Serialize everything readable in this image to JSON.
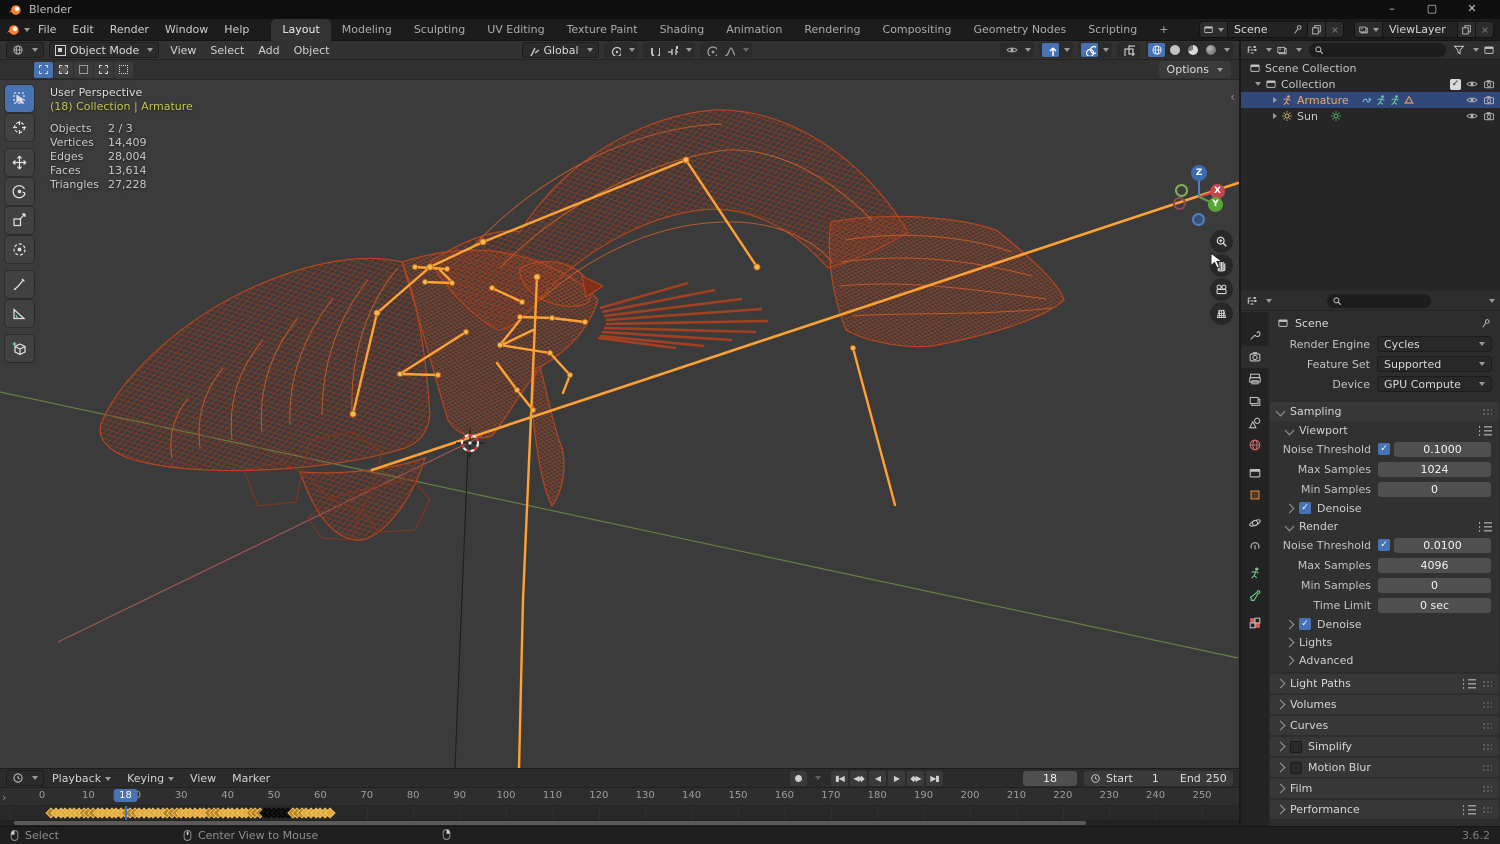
{
  "app": {
    "title": "Blender",
    "version": "3.6.2"
  },
  "colors": {
    "accent": "#4772b3",
    "selection_orange": "#ffa133",
    "wire": "#b5461f",
    "keyframe": "#e3aa3c",
    "selected_row": "#31497a"
  },
  "titlebar": {
    "minimize": "–",
    "maximize": "▢",
    "close": "✕"
  },
  "topbar": {
    "menus": [
      {
        "label": "File"
      },
      {
        "label": "Edit"
      },
      {
        "label": "Render"
      },
      {
        "label": "Window"
      },
      {
        "label": "Help"
      }
    ],
    "tabs": [
      {
        "label": "Layout",
        "active": true
      },
      {
        "label": "Modeling"
      },
      {
        "label": "Sculpting"
      },
      {
        "label": "UV Editing"
      },
      {
        "label": "Texture Paint"
      },
      {
        "label": "Shading"
      },
      {
        "label": "Animation"
      },
      {
        "label": "Rendering"
      },
      {
        "label": "Compositing"
      },
      {
        "label": "Geometry Nodes"
      },
      {
        "label": "Scripting"
      },
      {
        "label": "+",
        "add": true
      }
    ],
    "scene": "Scene",
    "view_layer": "ViewLayer"
  },
  "viewport": {
    "header": {
      "mode": "Object Mode",
      "menus": [
        {
          "label": "View"
        },
        {
          "label": "Select"
        },
        {
          "label": "Add"
        },
        {
          "label": "Object"
        }
      ],
      "orientation": "Global",
      "options": "Options"
    },
    "overlay": {
      "view": "User Perspective",
      "context": "(18) Collection | Armature",
      "stats": [
        {
          "label": "Objects",
          "value": "2 / 3"
        },
        {
          "label": "Vertices",
          "value": "14,409"
        },
        {
          "label": "Edges",
          "value": "28,004"
        },
        {
          "label": "Faces",
          "value": "13,614"
        },
        {
          "label": "Triangles",
          "value": "27,228"
        }
      ]
    },
    "gizmo": {
      "x": "X",
      "y": "Y",
      "z": "Z"
    },
    "tools": [
      "select-box",
      "cursor",
      "move",
      "rotate",
      "scale",
      "transform",
      "annotate",
      "measure",
      "add-cube"
    ]
  },
  "outliner": {
    "scene_collection": "Scene Collection",
    "collection": "Collection",
    "armature": "Armature",
    "sun": "Sun"
  },
  "properties": {
    "breadcrumb": "Scene",
    "fields": [
      {
        "label": "Render Engine",
        "value": "Cycles"
      },
      {
        "label": "Feature Set",
        "value": "Supported"
      },
      {
        "label": "Device",
        "value": "GPU Compute"
      }
    ],
    "sampling": {
      "title": "Sampling",
      "viewport": {
        "title": "Viewport",
        "rows": [
          {
            "label": "Noise Threshold",
            "value": "0.1000",
            "checkbox": true
          },
          {
            "label": "Max Samples",
            "value": "1024"
          },
          {
            "label": "Min Samples",
            "value": "0"
          }
        ],
        "denoise": "Denoise"
      },
      "render": {
        "title": "Render",
        "rows": [
          {
            "label": "Noise Threshold",
            "value": "0.0100",
            "checkbox": true
          },
          {
            "label": "Max Samples",
            "value": "4096"
          },
          {
            "label": "Min Samples",
            "value": "0"
          },
          {
            "label": "Time Limit",
            "value": "0 sec"
          }
        ],
        "denoise": "Denoise"
      },
      "collapsed": [
        {
          "label": "Lights"
        },
        {
          "label": "Advanced"
        }
      ]
    },
    "panels": [
      {
        "label": "Light Paths",
        "preset": true
      },
      {
        "label": "Volumes"
      },
      {
        "label": "Curves"
      },
      {
        "label": "Simplify",
        "checkbox": true
      },
      {
        "label": "Motion Blur",
        "checkbox": true
      },
      {
        "label": "Film"
      },
      {
        "label": "Performance",
        "preset": true
      }
    ],
    "tabs": [
      "tool",
      "render",
      "output",
      "view-layer",
      "scene",
      "world",
      "collection",
      "object",
      "physics",
      "constraints",
      "data",
      "bone",
      "texture"
    ]
  },
  "timeline": {
    "menus": [
      {
        "label": "Playback",
        "drop": true
      },
      {
        "label": "Keying",
        "drop": true
      },
      {
        "label": "View"
      },
      {
        "label": "Marker"
      }
    ],
    "current_frame": "18",
    "start_label": "Start",
    "start_value": "1",
    "end_label": "End",
    "end_value": "250",
    "ticks": [
      0,
      10,
      20,
      30,
      40,
      50,
      60,
      70,
      80,
      90,
      100,
      110,
      120,
      130,
      140,
      150,
      160,
      170,
      180,
      190,
      200,
      210,
      220,
      230,
      240,
      250
    ],
    "keyframes": {
      "first": 2,
      "last": 62,
      "muted_from": 48,
      "muted_to": 53
    }
  },
  "statusbar": {
    "left": "Select",
    "middle": "Center View to Mouse",
    "version": "3.6.2"
  }
}
